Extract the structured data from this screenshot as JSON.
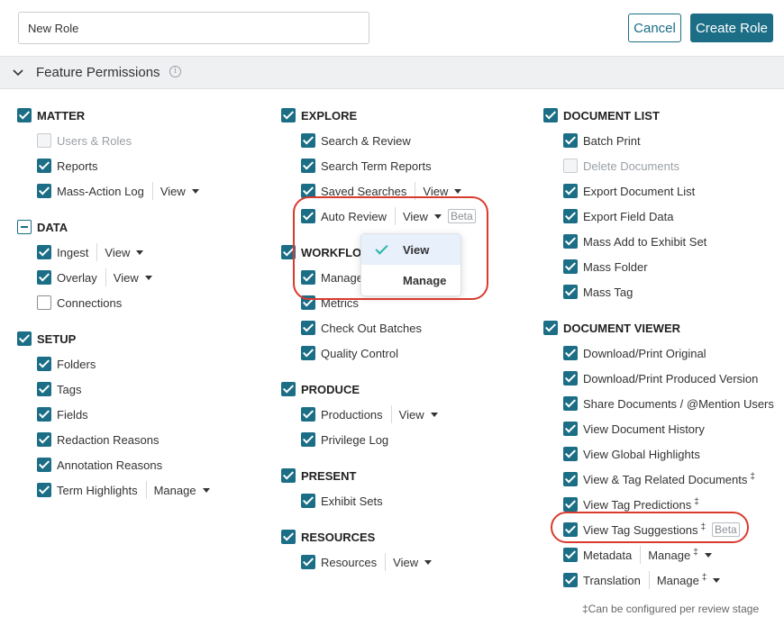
{
  "header": {
    "role_name_value": "New Role",
    "cancel_label": "Cancel",
    "create_label": "Create Role"
  },
  "section": {
    "title": "Feature Permissions",
    "info_glyph": "i"
  },
  "columns": {
    "col1": [
      {
        "label": "MATTER",
        "kind": "head",
        "state": "checked"
      },
      {
        "label": "Users & Roles",
        "state": "disabled"
      },
      {
        "label": "Reports",
        "state": "checked"
      },
      {
        "label": "Mass-Action Log",
        "state": "checked",
        "dropdown": "View"
      },
      {
        "label": "DATA",
        "kind": "head",
        "state": "indeterminate"
      },
      {
        "label": "Ingest",
        "state": "checked",
        "dropdown": "View"
      },
      {
        "label": "Overlay",
        "state": "checked",
        "dropdown": "View"
      },
      {
        "label": "Connections",
        "state": "unchecked"
      },
      {
        "label": "SETUP",
        "kind": "head",
        "state": "checked"
      },
      {
        "label": "Folders",
        "state": "checked"
      },
      {
        "label": "Tags",
        "state": "checked"
      },
      {
        "label": "Fields",
        "state": "checked"
      },
      {
        "label": "Redaction Reasons",
        "state": "checked"
      },
      {
        "label": "Annotation Reasons",
        "state": "checked"
      },
      {
        "label": "Term Highlights",
        "state": "checked",
        "dropdown": "Manage"
      }
    ],
    "col2": [
      {
        "label": "EXPLORE",
        "kind": "head",
        "state": "checked"
      },
      {
        "label": "Search & Review",
        "state": "checked"
      },
      {
        "label": "Search Term Reports",
        "state": "checked"
      },
      {
        "label": "Saved Searches",
        "state": "checked",
        "dropdown": "View"
      },
      {
        "label": "Auto Review",
        "state": "checked",
        "dropdown": "View",
        "beta": "Beta"
      },
      {
        "label": "WORKFLOW",
        "kind": "head",
        "state": "checked"
      },
      {
        "label": "Manage",
        "state": "checked"
      },
      {
        "label": "Metrics",
        "state": "checked"
      },
      {
        "label": "Check Out Batches",
        "state": "checked"
      },
      {
        "label": "Quality Control",
        "state": "checked"
      },
      {
        "label": "PRODUCE",
        "kind": "head",
        "state": "checked"
      },
      {
        "label": "Productions",
        "state": "checked",
        "dropdown": "View"
      },
      {
        "label": "Privilege Log",
        "state": "checked"
      },
      {
        "label": "PRESENT",
        "kind": "head",
        "state": "checked"
      },
      {
        "label": "Exhibit Sets",
        "state": "checked"
      },
      {
        "label": "RESOURCES",
        "kind": "head",
        "state": "checked"
      },
      {
        "label": "Resources",
        "state": "checked",
        "dropdown": "View"
      }
    ],
    "col3": [
      {
        "label": "DOCUMENT LIST",
        "kind": "head",
        "state": "checked"
      },
      {
        "label": "Batch Print",
        "state": "checked"
      },
      {
        "label": "Delete Documents",
        "state": "disabled"
      },
      {
        "label": "Export Document List",
        "state": "checked"
      },
      {
        "label": "Export Field Data",
        "state": "checked"
      },
      {
        "label": "Mass Add to Exhibit Set",
        "state": "checked"
      },
      {
        "label": "Mass Folder",
        "state": "checked"
      },
      {
        "label": "Mass Tag",
        "state": "checked"
      },
      {
        "label": "DOCUMENT VIEWER",
        "kind": "head",
        "state": "checked"
      },
      {
        "label": "Download/Print Original",
        "state": "checked"
      },
      {
        "label": "Download/Print Produced Version",
        "state": "checked"
      },
      {
        "label": "Share Documents / @Mention Users",
        "state": "checked"
      },
      {
        "label": "View Document History",
        "state": "checked"
      },
      {
        "label": "View Global Highlights",
        "state": "checked"
      },
      {
        "label": "View & Tag Related Documents",
        "state": "checked",
        "dagger": "‡"
      },
      {
        "label": "View Tag Predictions",
        "state": "checked",
        "dagger": "‡"
      },
      {
        "label": "View Tag Suggestions",
        "state": "checked",
        "dagger": "‡",
        "beta": "Beta"
      },
      {
        "label": "Metadata",
        "state": "checked",
        "dropdown": "Manage",
        "dropdown_dagger": "‡"
      },
      {
        "label": "Translation",
        "state": "checked",
        "dropdown": "Manage",
        "dropdown_dagger": "‡"
      }
    ]
  },
  "popup": {
    "options": [
      "View",
      "Manage"
    ],
    "selected": "View"
  },
  "footnote": "‡Can be configured per review stage",
  "colors": {
    "accent": "#1b6e86",
    "highlight_ring": "#d93a2e",
    "check_mark": "#2bb5a7"
  }
}
